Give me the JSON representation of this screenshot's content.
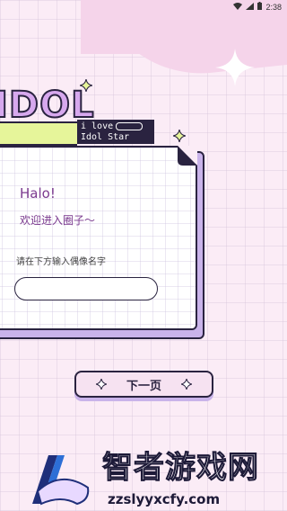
{
  "status_bar": {
    "time": "2:38"
  },
  "logo": {
    "text": "IDOL"
  },
  "tag": {
    "line1": "i love",
    "line2": "Idol Star"
  },
  "card": {
    "greeting": "Halo!",
    "welcome": "欢迎进入圈子～",
    "prompt": "请在下方输入偶像名字",
    "input_value": "",
    "input_placeholder": ""
  },
  "next_button": {
    "label": "下一页"
  },
  "watermark": {
    "title": "智者游戏网",
    "url": "zzslyyxcfy.com"
  },
  "colors": {
    "background": "#fbecf6",
    "accent": "#7b3a8f",
    "outline": "#2a2340",
    "shadow": "#c9b3ea",
    "lime": "#e6f59a"
  }
}
